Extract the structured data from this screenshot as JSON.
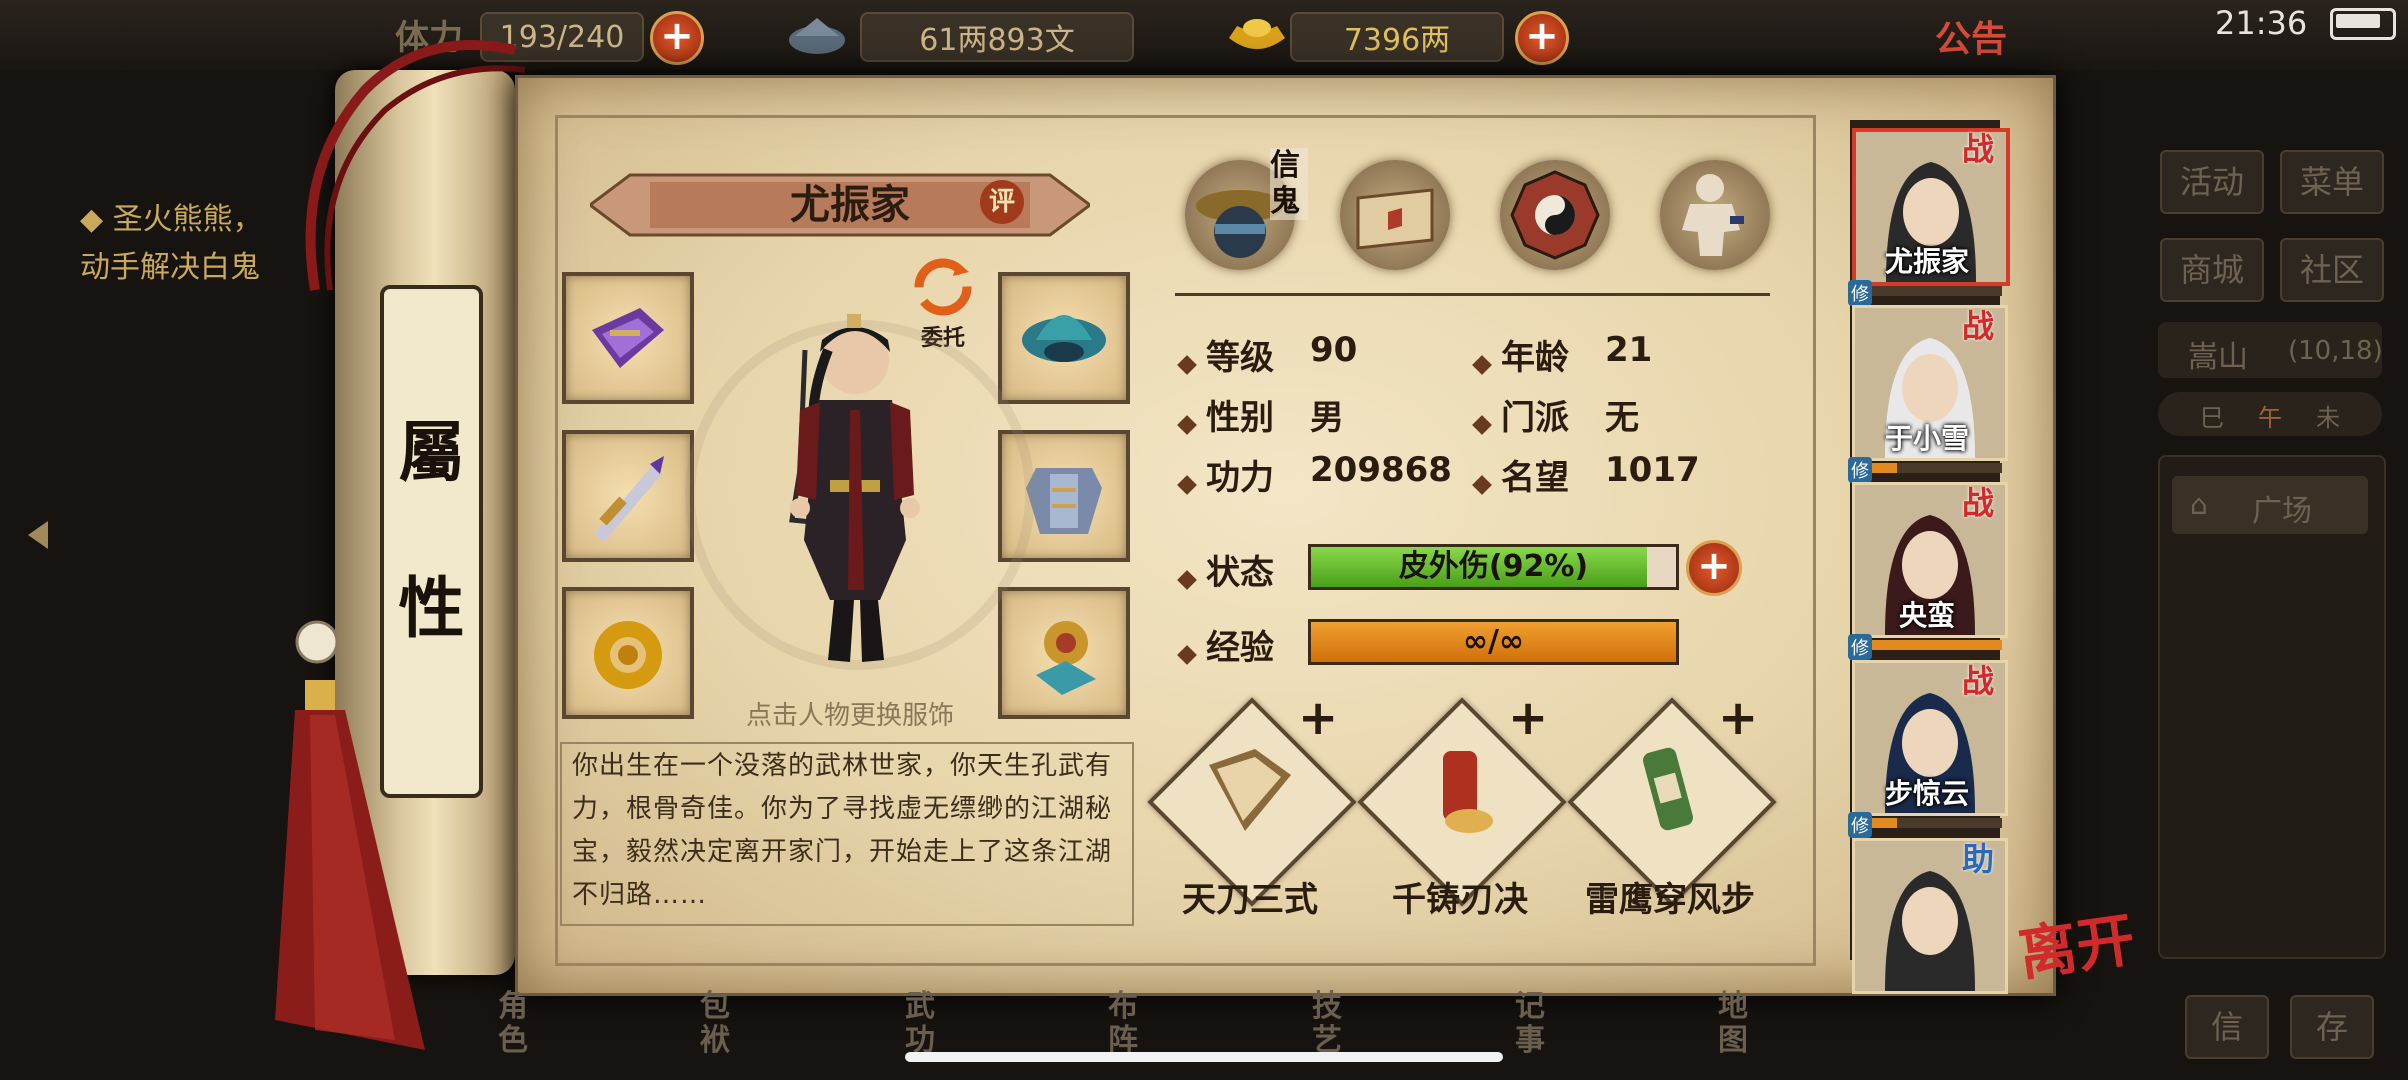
{
  "status_bar": {
    "time": "21:36"
  },
  "topbar": {
    "stamina_label": "体力",
    "stamina_value": "193/240",
    "money_value": "61两893文",
    "gold_value": "7396两",
    "notice_label": "公告"
  },
  "quest": {
    "line1": "◆ 圣火熊熊，",
    "line2": "动手解决白鬼"
  },
  "scroll": {
    "title_top": "屬",
    "title_bottom": "性"
  },
  "character": {
    "name": "尤振家",
    "review_label": "评",
    "delegate_label": "委托",
    "change_outfit_hint": "点击人物更换服饰",
    "bio": "你出生在一个没落的武林世家，你天生孔武有力，根骨奇佳。你为了寻找虚无缥缈的江湖秘宝，毅然决定离开家门，开始走上了这条江湖不归路……"
  },
  "top_icons": {
    "letter_label": "信鬼"
  },
  "stats": {
    "level_label": "等级",
    "level": "90",
    "age_label": "年龄",
    "age": "21",
    "gender_label": "性别",
    "gender": "男",
    "sect_label": "门派",
    "sect": "无",
    "power_label": "功力",
    "power": "209868",
    "fame_label": "名望",
    "fame": "1017",
    "status_label": "状态",
    "status_text": "皮外伤(92%)",
    "status_fill": 0.92,
    "exp_label": "经验",
    "exp_text": "∞/∞",
    "exp_fill": 1.0
  },
  "skills": [
    {
      "name": "天刀三式",
      "plus": "+"
    },
    {
      "name": "千铸刃决",
      "plus": "+"
    },
    {
      "name": "雷鹰穿风步",
      "plus": "+"
    }
  ],
  "party": [
    {
      "name": "尤振家",
      "badge": "战",
      "xiu": "修",
      "fill": 0.0
    },
    {
      "name": "于小雪",
      "badge": "战",
      "xiu": "修",
      "fill": 0.3
    },
    {
      "name": "央蛮",
      "badge": "战",
      "xiu": "修",
      "fill": 1.0
    },
    {
      "name": "步惊云",
      "badge": "战",
      "xiu": "修",
      "fill": 0.3
    },
    {
      "name": "",
      "badge": "助",
      "xiu": "",
      "fill": 0.0
    }
  ],
  "leave_label": "离开",
  "right_menu": {
    "activity": "活动",
    "menu": "菜单",
    "shop": "商城",
    "community": "社区",
    "location": "嵩山",
    "coords": "(10,18)",
    "time_slots": [
      "巳",
      "午",
      "未"
    ],
    "place": "广场",
    "letter": "信",
    "save": "存"
  },
  "bottom_nav": [
    "角色",
    "包袱",
    "武功",
    "布阵",
    "技艺",
    "记事",
    "地图"
  ],
  "colors": {
    "status_bar": "#5cbf2a",
    "exp_bar": "#e0801a",
    "accent_red": "#d22a2a",
    "paper": "#ecdcb6"
  }
}
